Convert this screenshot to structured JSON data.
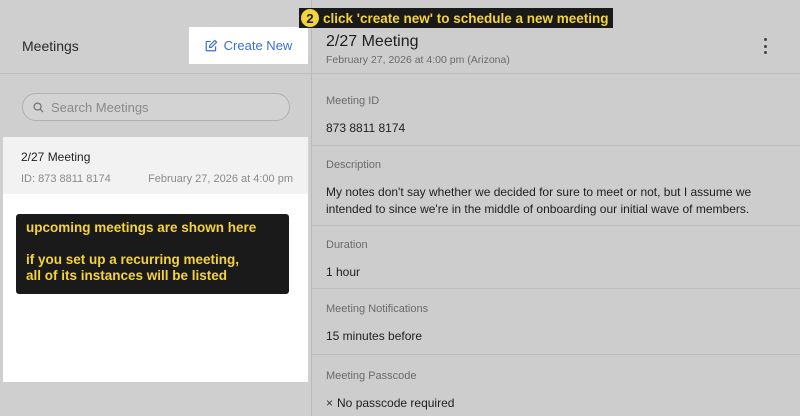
{
  "step_banner": {
    "number": "2",
    "text": "click 'create new' to schedule a new meeting"
  },
  "left": {
    "title": "Meetings",
    "create_label": "Create New",
    "search_placeholder": "Search Meetings",
    "meetings": [
      {
        "title": "2/27 Meeting",
        "id": "ID: 873 8811 8174",
        "date": "February 27, 2026 at 4:00 pm"
      }
    ],
    "callout": {
      "line1": "upcoming meetings are shown here",
      "line2": "if you set up a recurring meeting,",
      "line3": "all of its instances will be listed"
    }
  },
  "detail": {
    "title": "2/27 Meeting",
    "subtitle": "February 27, 2026 at 4:00 pm (Arizona)",
    "meeting_id_label": "Meeting ID",
    "meeting_id": "873 8811 8174",
    "description_label": "Description",
    "description": "My notes don't say whether we decided for sure to meet or not, but I assume we intended to since we're in the middle of onboarding our initial wave of members.",
    "duration_label": "Duration",
    "duration": "1 hour",
    "notifications_label": "Meeting Notifications",
    "notifications": "15 minutes before",
    "passcode_label": "Meeting Passcode",
    "passcode_mark": "×",
    "passcode": "No passcode required"
  },
  "colors": {
    "accent": "#3a6fd8",
    "callout_text": "#f4d43a",
    "callout_bg": "#1a1a1a"
  }
}
